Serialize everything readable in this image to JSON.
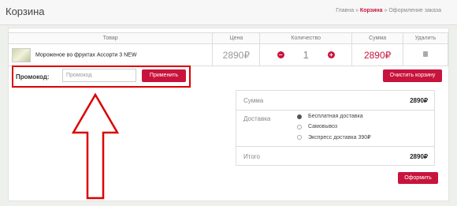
{
  "header": {
    "title": "Корзина",
    "breadcrumb": {
      "home": "Главна",
      "sep": " » ",
      "current": "Корзина",
      "next": "Оформление заказа"
    }
  },
  "table": {
    "headers": [
      "Товар",
      "Цена",
      "Количество",
      "Сумма",
      "Удалить"
    ],
    "row": {
      "name": "Мороженое во фруктах Ассорти 3 NEW",
      "price": "2890₽",
      "qty": "1",
      "sum": "2890₽"
    }
  },
  "promo": {
    "label": "Промокод:",
    "placeholder": "Промокод",
    "apply": "Применить"
  },
  "clear_cart": "Очистить корзину",
  "summary": {
    "sum_label": "Сумма",
    "sum_value": "2890₽",
    "delivery_label": "Доставка",
    "delivery_options": [
      "Бесплатная доставка",
      "Самовывоз",
      "Экспресс доставка 390₽"
    ],
    "selected_option": 0,
    "total_label": "Итого",
    "total_value": "2890₽"
  },
  "order_button": "Оформить",
  "colors": {
    "accent": "#c8143c",
    "annotation": "#dd0000"
  }
}
